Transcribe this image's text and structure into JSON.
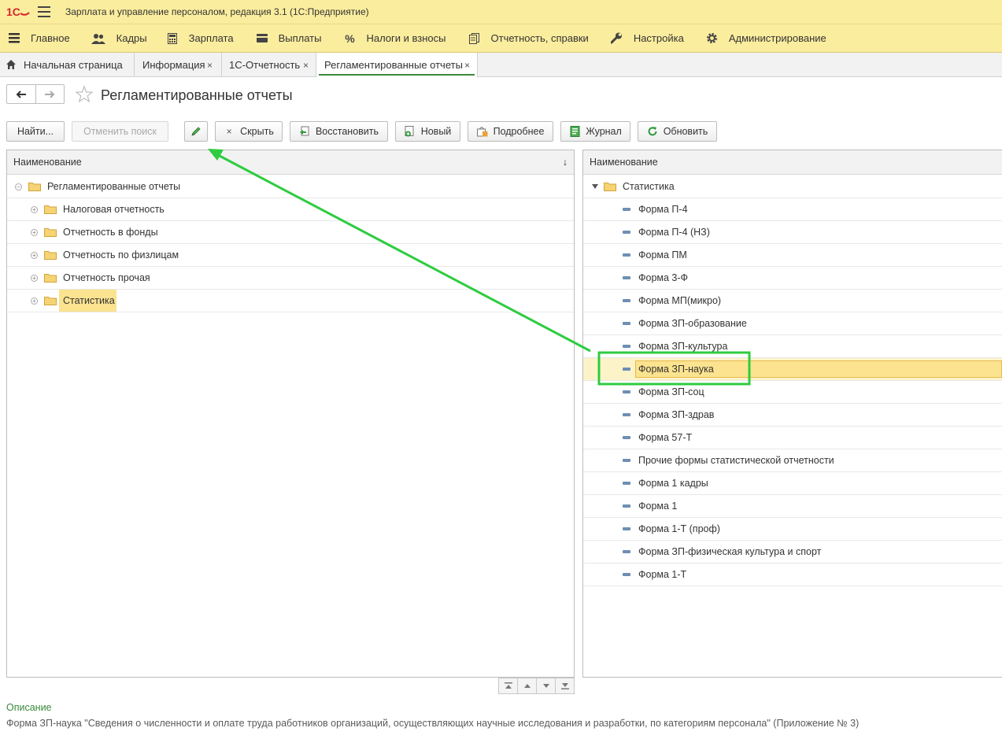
{
  "titlebar": {
    "title": "Зарплата и управление персоналом, редакция 3.1   (1С:Предприятие)"
  },
  "sections": [
    {
      "label": "Главное",
      "icon": "menu-icon"
    },
    {
      "label": "Кадры",
      "icon": "people-icon"
    },
    {
      "label": "Зарплата",
      "icon": "calculator-icon"
    },
    {
      "label": "Выплаты",
      "icon": "card-icon"
    },
    {
      "label": "Налоги и взносы",
      "icon": "percent-icon"
    },
    {
      "label": "Отчетность, справки",
      "icon": "documents-icon"
    },
    {
      "label": "Настройка",
      "icon": "wrench-icon"
    },
    {
      "label": "Администрирование",
      "icon": "gear-icon"
    }
  ],
  "tabs": [
    {
      "label": "Начальная страница",
      "icon": "home-icon"
    },
    {
      "label": "Информация",
      "close": "×"
    },
    {
      "label": "1С-Отчетность",
      "close": "×"
    },
    {
      "label": "Регламентированные отчеты",
      "close": "×"
    }
  ],
  "form": {
    "title": "Регламентированные отчеты"
  },
  "toolbar": {
    "find": "Найти...",
    "cancel_search": "Отменить поиск",
    "hide": "Скрыть",
    "hide_mark": "×",
    "restore": "Восстановить",
    "new": "Новый",
    "details": "Подробнее",
    "journal": "Журнал",
    "refresh": "Обновить"
  },
  "left_tree": {
    "header": "Наименование",
    "sort_indicator": "↓",
    "root": "Регламентированные отчеты",
    "items": [
      "Налоговая отчетность",
      "Отчетность в фонды",
      "Отчетность по физлицам",
      "Отчетность прочая",
      "Статистика"
    ],
    "selected": "Статистика"
  },
  "right_list": {
    "header": "Наименование",
    "group": "Статистика",
    "items": [
      "Форма П-4",
      "Форма П-4 (НЗ)",
      "Форма ПМ",
      "Форма 3-Ф",
      "Форма МП(микро)",
      "Форма ЗП-образование",
      "Форма ЗП-культура",
      "Форма ЗП-наука",
      "Форма ЗП-соц",
      "Форма ЗП-здрав",
      "Форма 57-Т",
      "Прочие формы статистической отчетности",
      "Форма 1 кадры",
      "Форма 1",
      "Форма 1-Т (проф)",
      "Форма ЗП-физическая культура и спорт",
      "Форма 1-Т"
    ],
    "selected": "Форма ЗП-наука"
  },
  "description": {
    "title": "Описание",
    "text": "Форма ЗП-наука  \"Сведения о численности и оплате труда  работников организаций, осуществляющих  научные исследования и разработки, по категориям персонала\" (Приложение № 3)"
  },
  "colors": {
    "header_bg": "#fbed9e",
    "selection": "#fbe38f",
    "annotation": "#2ecc40",
    "accent_green": "#3a8a3a"
  }
}
